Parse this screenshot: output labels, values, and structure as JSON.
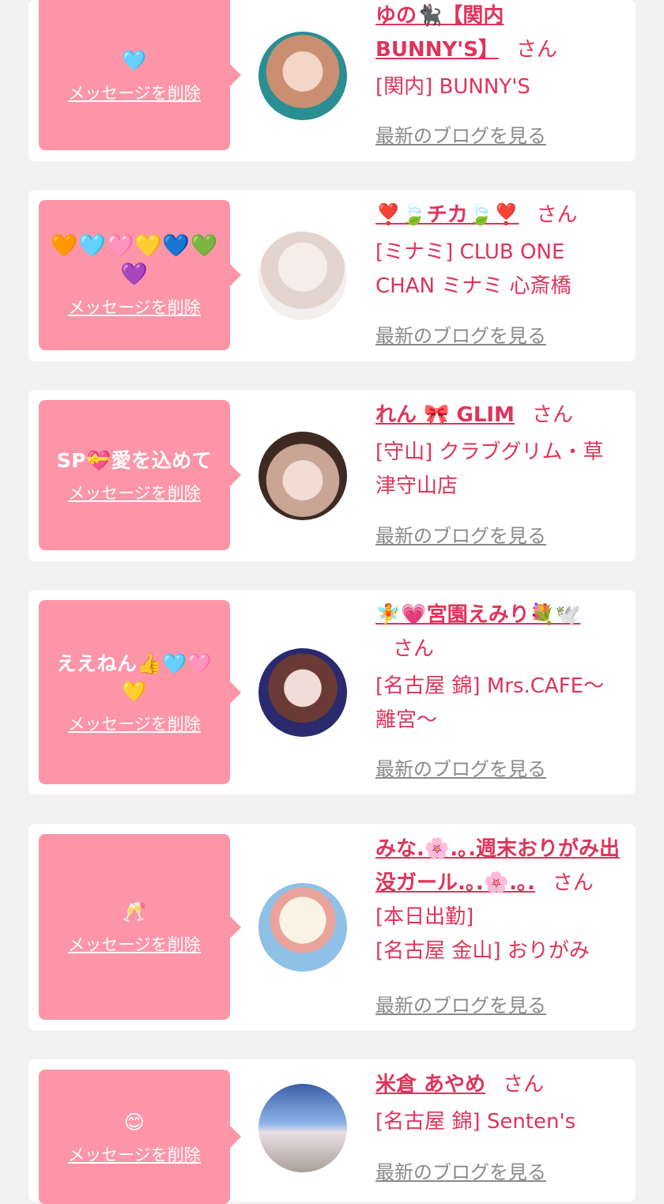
{
  "delete_label": "メッセージを削除",
  "blog_label": "最新のブログを見る",
  "san_label": "さん",
  "colors": {
    "bubble": "#fd95a8",
    "accent": "#e0335a",
    "muted": "#8a8a8a",
    "background": "#f2f2f2"
  },
  "items": [
    {
      "message": "🩵",
      "name": "ゆの🐈‍⬛【関内BUNNY'S】",
      "shop": "[関内] BUNNY'S",
      "shop_lines": []
    },
    {
      "message": "🧡🩵🩷💛💙💚💜",
      "name": "❣️🍃チカ🍃❣️",
      "shop": "[ミナミ] CLUB ONE CHAN ミナミ 心斎橋",
      "shop_lines": []
    },
    {
      "message": "SP💝愛を込めて",
      "name": "れん 🎀 GLIM",
      "shop": "[守山] クラブグリム・草津守山店",
      "shop_lines": []
    },
    {
      "message": "ええねん👍🩵🩷💛",
      "name": "🧚💗宮園えみり💐🕊️",
      "shop": "[名古屋 錦] Mrs.CAFE〜離宮〜",
      "shop_lines": []
    },
    {
      "message": "🥂",
      "name": "みな.🌸.｡.週末おりがみ出没ガール.｡.🌸.｡.",
      "shop_lines": [
        "[本日出勤]",
        "[名古屋 金山] おりがみ"
      ]
    },
    {
      "message": "😊",
      "name": "米倉 あやめ",
      "shop": "[名古屋 錦] Senten's",
      "shop_lines": []
    }
  ]
}
